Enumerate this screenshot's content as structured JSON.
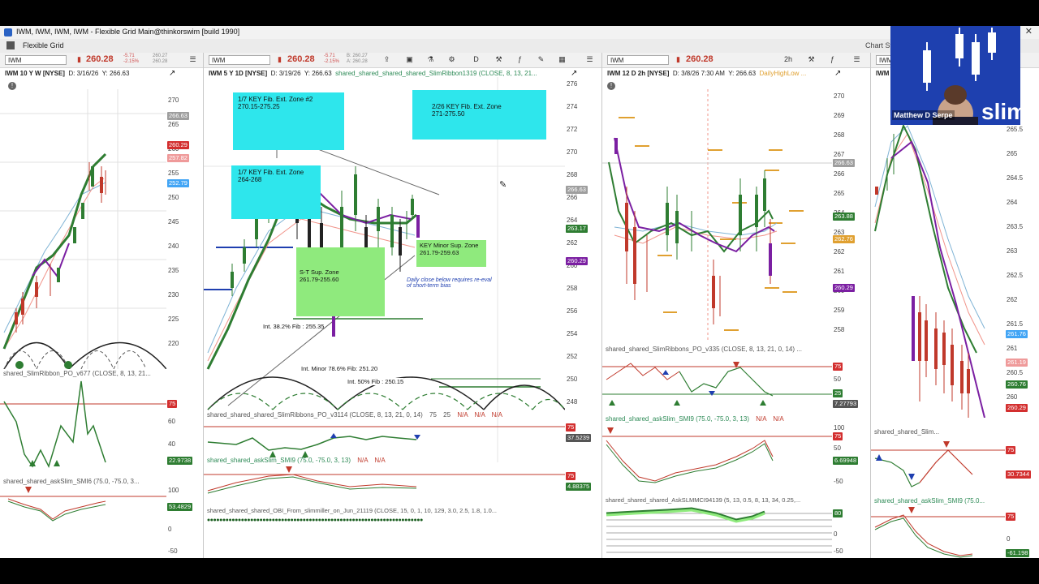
{
  "window": {
    "title": "IWM, IWM, IWM, IWM - Flexible Grid Main@thinkorswim [build 1990]"
  },
  "grid": {
    "name": "Flexible Grid",
    "right_label": "Chart St"
  },
  "panels": [
    {
      "symbol": "IWM",
      "price": "260.28",
      "chg1": "-5.71",
      "chg2": "-2.15%",
      "bid": "260.27",
      "ask": "260.28",
      "info_title": "IWM 10 Y W [NYSE]",
      "info_date": "D: 3/16/26",
      "info_y": "Y: 266.63",
      "study1": "shared_SlimRibbon_PO_v677 (CLOSE, 8, 13, 21...",
      "study2": "shared_shared_askSlim_SMI6 (75.0, -75.0, 3...",
      "y_axis": [
        "270",
        "265",
        "260",
        "255",
        "250",
        "245",
        "240",
        "235",
        "230",
        "225",
        "220"
      ],
      "tags": [
        {
          "v": "266.63",
          "c": "#9e9e9e"
        },
        {
          "v": "260.29",
          "c": "#d32f2f"
        },
        {
          "v": "257.82",
          "c": "#ef9a9a"
        },
        {
          "v": "252.79",
          "c": "#42a5f5"
        }
      ],
      "osc1_axis": [
        "75",
        "60",
        "40",
        "20"
      ],
      "osc1_tag": "22.9738",
      "osc2_axis": [
        "100",
        "50",
        "0",
        "-50"
      ],
      "osc2_tag": "53.4829"
    },
    {
      "symbol": "IWM",
      "price": "260.28",
      "chg1": "-5.71",
      "chg2": "-2.15%",
      "bid": "B: 260.27",
      "ask": "A: 260.28",
      "info_title": "IWM 5 Y 1D [NYSE]",
      "info_date": "D: 3/19/26",
      "info_y": "Y: 266.63",
      "info_study": "shared_shared_shared_shared_SlimRibbon1319 (CLOSE, 8, 13, 21...",
      "study1": "shared_shared_shared_SlimRibbons_PO_v3114 (CLOSE, 8, 13, 21, 0, 14)",
      "study1_extra": [
        "75",
        "25",
        "N/A",
        "N/A",
        "N/A"
      ],
      "study2": "shared_shared_askSlim_SMI9 (75.0, -75.0, 3, 13)",
      "study2_extra": [
        "N/A",
        "N/A"
      ],
      "study3": "shared_shared_shared_OBI_From_slimmiller_on_Jun_21119 (CLOSE, 15, 0, 1, 10, 129, 3.0, 2.5, 1.8, 1.0...",
      "y_axis": [
        "276",
        "274",
        "272",
        "270",
        "268",
        "266",
        "264",
        "262",
        "260",
        "258",
        "256",
        "254",
        "252",
        "250",
        "248"
      ],
      "tags": [
        {
          "v": "266.63",
          "c": "#9e9e9e"
        },
        {
          "v": "263.17",
          "c": "#2e7d32"
        },
        {
          "v": "260.29",
          "c": "#7b1fa2"
        }
      ],
      "osc1_axis": [
        "75"
      ],
      "osc1_tag": "37.5239",
      "osc2_axis": [
        "75"
      ],
      "osc2_tag": "4.88375",
      "zones": {
        "z1": "1/7 KEY Fib. Ext. Zone #2\n270.15-275.25",
        "z2": "2/26 KEY Fib. Ext. Zone\n271-275.50",
        "z3": "1/7 KEY Fib. Ext. Zone\n264-268",
        "z4": "KEY Minor Sup. Zone\n261.79-259.63",
        "z5": "S-T Sup. Zone\n261.79-255.60",
        "note": "Daily close below requires re-eval\nof short-term bias",
        "fib1": "Int. 38.2% Fib : 255.35",
        "fib2": "Int. Minor 78.6% Fib: 251.20",
        "fib3": "Int. 50% Fib : 250.15"
      }
    },
    {
      "symbol": "IWM",
      "price": "260.28",
      "tf": "2h",
      "info_title": "IWM 12 D 2h [NYSE]",
      "info_date": "D: 3/8/26 7:30 AM",
      "info_y": "Y: 266.63",
      "info_study": "DailyHighLow ...",
      "study1": "shared_shared_SlimRibbons_PO_v335 (CLOSE, 8, 13, 21, 0, 14) ...",
      "study2": "shared_shared_askSlim_SMI9 (75.0, -75.0, 3, 13)",
      "study2_extra": [
        "N/A",
        "N/A"
      ],
      "study3": "shared_shared_shared_AskSLMMCI94139 (5, 13, 0.5, 8, 13, 34, 0.25,...",
      "y_axis": [
        "270",
        "269",
        "268",
        "267",
        "266",
        "265",
        "264",
        "263",
        "262",
        "261",
        "260",
        "259",
        "258"
      ],
      "tags": [
        {
          "v": "266.63",
          "c": "#9e9e9e"
        },
        {
          "v": "263.88",
          "c": "#2e7d32"
        },
        {
          "v": "262.76",
          "c": "#e0a030"
        },
        {
          "v": "260.29",
          "c": "#7b1fa2"
        }
      ],
      "osc1_axis": [
        "75",
        "50",
        "25"
      ],
      "osc1_tag": "7.27793",
      "osc2_axis": [
        "100",
        "75",
        "50",
        "-50"
      ],
      "osc2_tag": "6.69948",
      "osc3_axis": [
        "80",
        "0",
        "-50"
      ]
    },
    {
      "symbol": "IWM",
      "info_title": "IWM",
      "study1": "shared_shared_Slim...",
      "study2": "shared_shared_askSlim_SMI9 (75.0...",
      "y_axis": [
        "265.5",
        "265",
        "264.5",
        "264",
        "263.5",
        "263",
        "262.5",
        "262",
        "261.5",
        "261",
        "260.5",
        "260"
      ],
      "tags": [
        {
          "v": "261.76",
          "c": "#42a5f5"
        },
        {
          "v": "261.19",
          "c": "#ef9a9a"
        },
        {
          "v": "260.76",
          "c": "#2e7d32"
        },
        {
          "v": "260.29",
          "c": "#d32f2f"
        }
      ],
      "osc1_axis": [
        "75"
      ],
      "osc1_tag": "30.7344",
      "osc2_axis": [
        "75",
        "0"
      ],
      "osc2_tag": "-61.198"
    }
  ],
  "webcam": {
    "name": "Matthew D Serpe",
    "logo": "slim"
  }
}
